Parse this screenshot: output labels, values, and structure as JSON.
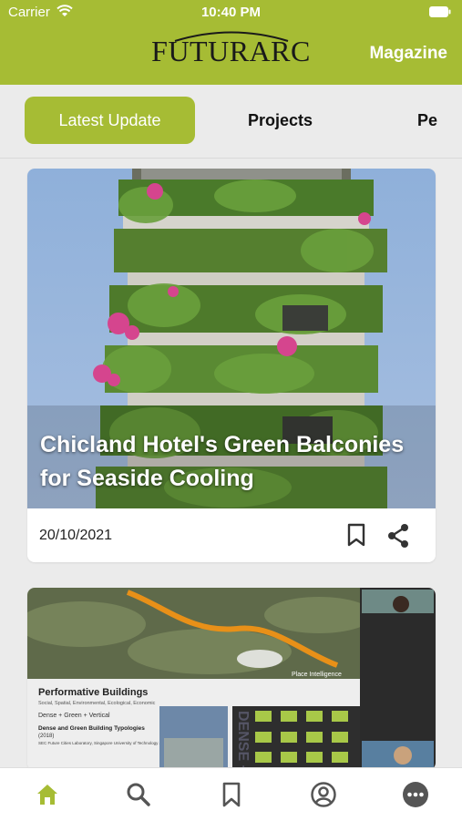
{
  "status": {
    "carrier": "Carrier",
    "time": "10:40 PM"
  },
  "header": {
    "logo_text": "FUTURARC",
    "magazine_label": "Magazine",
    "bg_color": "#a6bc34"
  },
  "tabs": [
    {
      "label": "Latest Update",
      "active": true
    },
    {
      "label": "Projects",
      "active": false
    },
    {
      "label": "Pe",
      "active": false
    }
  ],
  "feed": [
    {
      "title": "Chicland Hotel's Green Balconies for Seaside Cooling",
      "date": "20/10/2021"
    },
    {
      "slide_heading": "Performative Buildings",
      "slide_sub": "Social, Spatial, Environmental, Ecological, Economic",
      "slide_line": "Dense + Green + Vertical",
      "slide_title2": "Dense and Green Building Typologies",
      "slide_year": "(2018)",
      "slide_credit": "SEC Future Cities Laboratory, Singapore University of Technology and Design (SUTD)",
      "map_label": "Place Intelligence",
      "vertical_text": "DENSE + G"
    }
  ],
  "bottom_nav": [
    {
      "icon": "home-icon",
      "active": true
    },
    {
      "icon": "search-icon",
      "active": false
    },
    {
      "icon": "bookmark-icon",
      "active": false
    },
    {
      "icon": "profile-icon",
      "active": false
    },
    {
      "icon": "more-icon",
      "active": false
    }
  ],
  "colors": {
    "accent": "#a6bc34",
    "inactive_icon": "#555555"
  }
}
